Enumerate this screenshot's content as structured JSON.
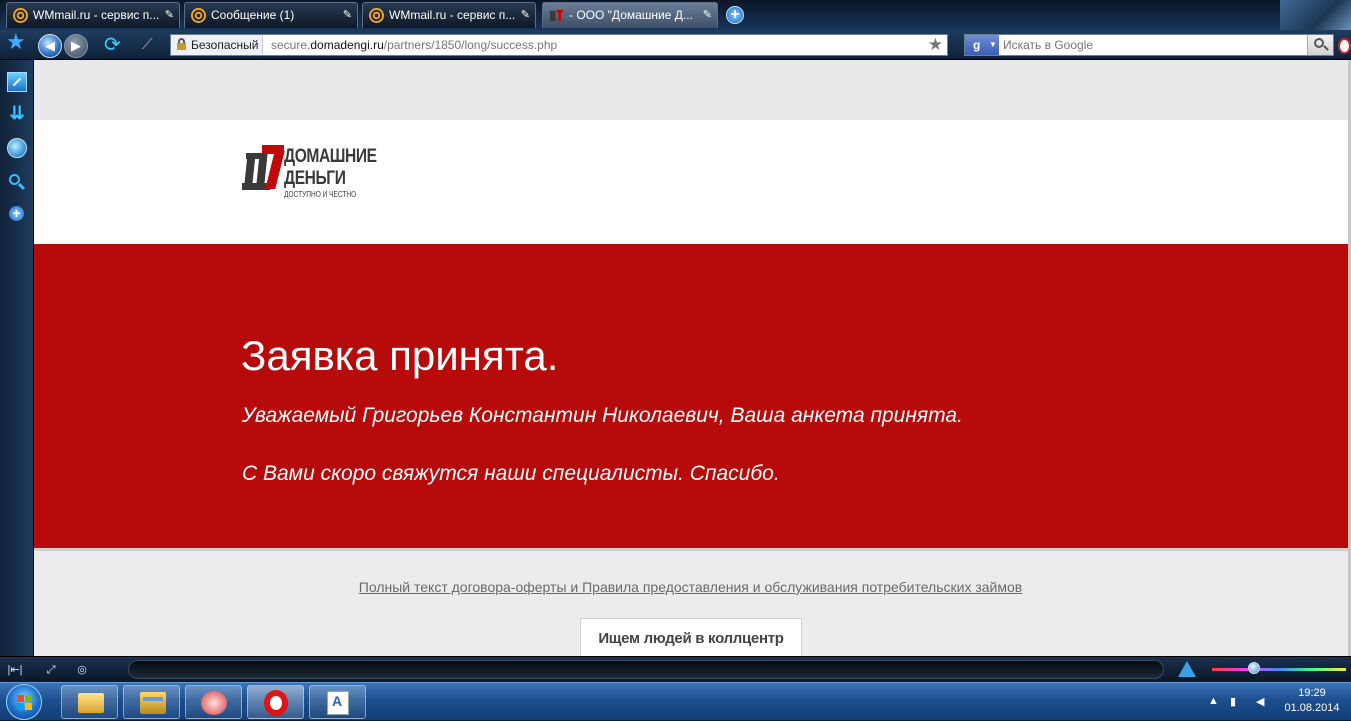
{
  "browser": {
    "tabs": [
      {
        "label": "WMmail.ru - сервис п...",
        "icon": "at-icon",
        "active": false
      },
      {
        "label": "Сообщение (1)",
        "icon": "at-icon",
        "active": false
      },
      {
        "label": "WMmail.ru - сервис п...",
        "icon": "at-icon",
        "active": false
      },
      {
        "label": "- ООО \"Домашние Д...",
        "icon": "domadengi-favicon",
        "active": true
      }
    ],
    "toolbar": {
      "security_label": "Безопасный",
      "url_prefix": "secure.",
      "url_domain": "domadengi.ru",
      "url_path": "/partners/1850/long/success.php",
      "search_placeholder": "Искать в Google"
    }
  },
  "page": {
    "logo": {
      "line1": "ДОМАШНИЕ",
      "line2": "ДЕНЬГИ",
      "tagline": "ДОСТУПНО И ЧЕСТНО"
    },
    "banner": {
      "title": "Заявка принята.",
      "line1": "Уважаемый Григорьев Константин Николаевич, Ваша анкета принята.",
      "line2": "С Вами скоро свяжутся наши специалисты. Спасибо."
    },
    "footer_link": "Полный текст договора-оферты и Правила предоставления и обслуживания потребительских займов",
    "recruit_button": "Ищем людей в коллцентр"
  },
  "taskbar": {
    "apps": [
      "sticky-notes",
      "windows-explorer",
      "snipping-tool",
      "opera",
      "document"
    ],
    "clock_time": "19:29",
    "clock_date": "01.08.2014"
  },
  "colors": {
    "banner_red": "#b70b0b",
    "logo_red": "#c00a0a",
    "logo_gray": "#3a3a3a"
  }
}
